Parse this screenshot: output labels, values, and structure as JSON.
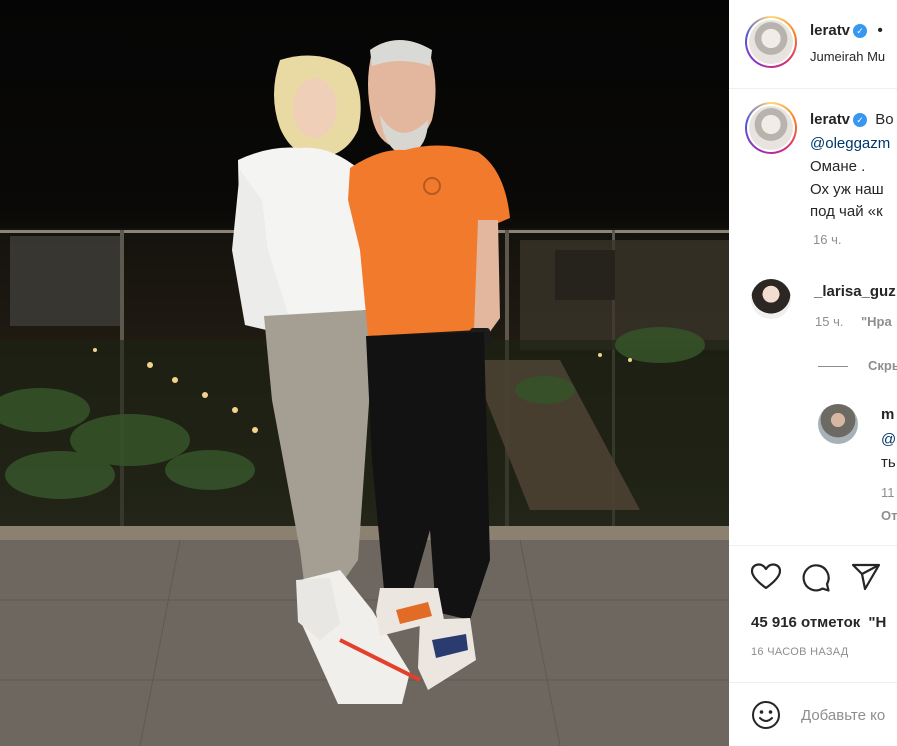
{
  "post": {
    "author": "leratv",
    "header_dot": "•",
    "location": "Jumeirah Mu",
    "caption_prefix": "Во",
    "caption_mention": "@oleggazm",
    "caption_lines": [
      "Омане .",
      "Ох уж наш",
      "под чай «к"
    ],
    "caption_time": "16 ч."
  },
  "comments": [
    {
      "username": "_larisa_guz",
      "time": "15 ч.",
      "like_label": "\"Нра"
    }
  ],
  "hide_replies_label": "Скры",
  "reply": {
    "username": "m",
    "mention": "@",
    "text": "ть",
    "time": "11",
    "reply_label": "От"
  },
  "likes_text": "45 916 отметок",
  "likes_suffix": "\"Н",
  "timestamp": "16 ЧАСОВ НАЗАД",
  "comment_placeholder": "Добавьте ко",
  "colors": {
    "verified": "#3897f0",
    "link": "#00376b",
    "secondary_text": "#8e8e8e",
    "shirt": "#f27a2d"
  },
  "icons": [
    "heart-icon",
    "comment-icon",
    "share-icon",
    "emoji-icon",
    "verified-badge-icon"
  ]
}
